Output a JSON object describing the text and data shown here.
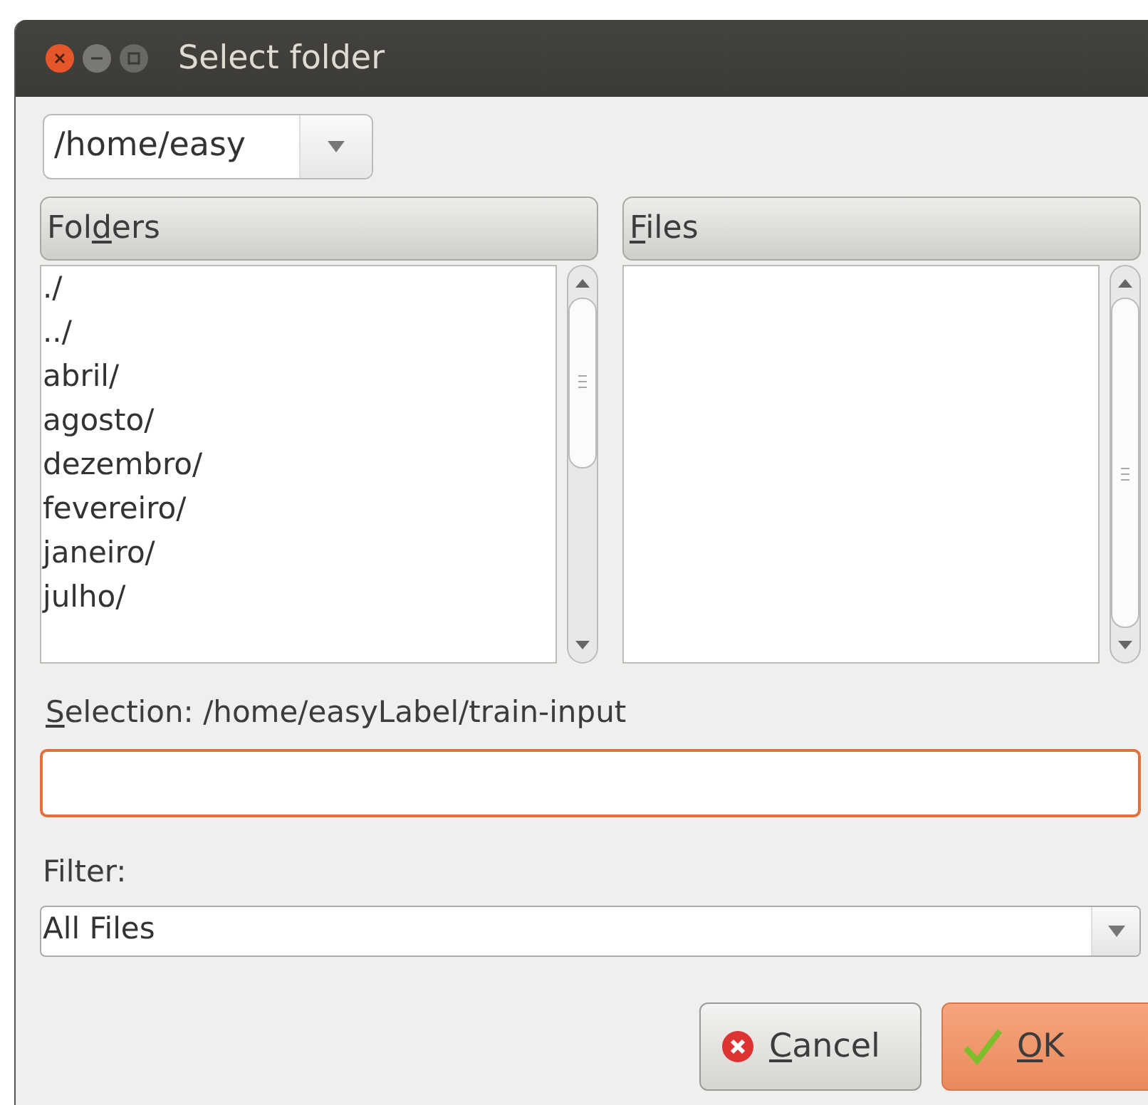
{
  "window": {
    "title": "Select folder"
  },
  "path_combo": {
    "value": "/home/easy"
  },
  "folders": {
    "header": {
      "before": "Fol",
      "key": "d",
      "after": "ers"
    },
    "items": [
      "./",
      "../",
      "abril/",
      "agosto/",
      "dezembro/",
      "fevereiro/",
      "janeiro/",
      "julho/"
    ]
  },
  "files": {
    "header": {
      "key": "F",
      "after": "iles"
    }
  },
  "selection": {
    "label": {
      "key": "S",
      "after": "election:"
    },
    "path": "/home/easyLabel/train-input",
    "focused": true
  },
  "filter": {
    "label": "Filter:",
    "value": "All Files"
  },
  "buttons": [
    {
      "kind": "cancel",
      "label": {
        "key": "C",
        "after": "ancel"
      },
      "default": false
    },
    {
      "kind": "ok",
      "label": {
        "key": "O",
        "after": "K"
      },
      "default": true
    }
  ]
}
